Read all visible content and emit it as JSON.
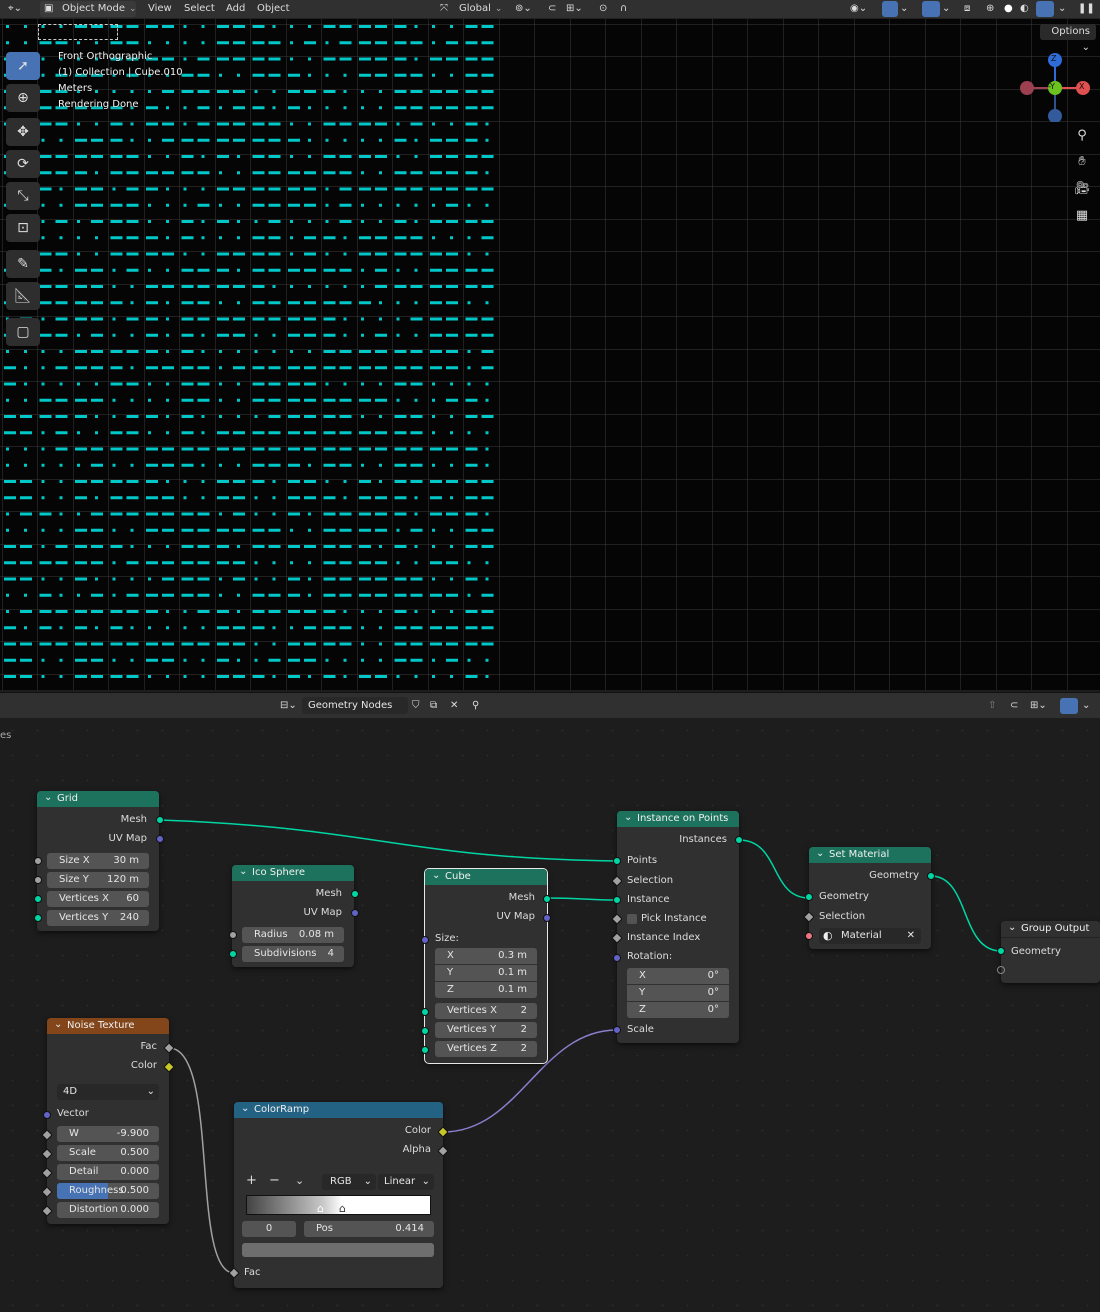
{
  "header": {
    "mode": "Object Mode",
    "menus": [
      "View",
      "Select",
      "Add",
      "Object"
    ],
    "transform_orientation": "Global"
  },
  "viewport": {
    "options_label": "Options",
    "overlay": [
      "Front Orthographic",
      "(1) Collection | Cube.010",
      "Meters",
      "Rendering Done"
    ],
    "gizmo": {
      "z": "Z",
      "y": "-Y",
      "x": "X"
    },
    "accent": "#00c8c8"
  },
  "node_header": {
    "tree_name": "Geometry Nodes"
  },
  "nodes": {
    "grid": {
      "title": "Grid",
      "out_mesh": "Mesh",
      "out_uv": "UV Map",
      "size_x": {
        "label": "Size X",
        "value": "30 m"
      },
      "size_y": {
        "label": "Size Y",
        "value": "120 m"
      },
      "verts_x": {
        "label": "Vertices X",
        "value": "60"
      },
      "verts_y": {
        "label": "Vertices Y",
        "value": "240"
      }
    },
    "ico": {
      "title": "Ico Sphere",
      "out_mesh": "Mesh",
      "out_uv": "UV Map",
      "radius": {
        "label": "Radius",
        "value": "0.08 m"
      },
      "subdiv": {
        "label": "Subdivisions",
        "value": "4"
      }
    },
    "cube": {
      "title": "Cube",
      "out_mesh": "Mesh",
      "out_uv": "UV Map",
      "size_label": "Size:",
      "x": {
        "label": "X",
        "value": "0.3 m"
      },
      "y": {
        "label": "Y",
        "value": "0.1 m"
      },
      "z": {
        "label": "Z",
        "value": "0.1 m"
      },
      "vx": {
        "label": "Vertices X",
        "value": "2"
      },
      "vy": {
        "label": "Vertices Y",
        "value": "2"
      },
      "vz": {
        "label": "Vertices Z",
        "value": "2"
      }
    },
    "iop": {
      "title": "Instance on Points",
      "out_instances": "Instances",
      "points": "Points",
      "selection": "Selection",
      "instance": "Instance",
      "pick": "Pick Instance",
      "index": "Instance Index",
      "rotation": "Rotation:",
      "rx": {
        "label": "X",
        "value": "0°"
      },
      "ry": {
        "label": "Y",
        "value": "0°"
      },
      "rz": {
        "label": "Z",
        "value": "0°"
      },
      "scale": "Scale"
    },
    "setmat": {
      "title": "Set Material",
      "out_geometry": "Geometry",
      "geometry": "Geometry",
      "selection": "Selection",
      "material": "Material"
    },
    "output": {
      "title": "Group Output",
      "geometry": "Geometry"
    },
    "noise": {
      "title": "Noise Texture",
      "out_fac": "Fac",
      "out_color": "Color",
      "dimensions": "4D",
      "vector": "Vector",
      "w": {
        "label": "W",
        "value": "-9.900"
      },
      "scale": {
        "label": "Scale",
        "value": "0.500"
      },
      "detail": {
        "label": "Detail",
        "value": "0.000"
      },
      "roughness": {
        "label": "Roughness",
        "value": "0.500"
      },
      "distortion": {
        "label": "Distortion",
        "value": "0.000"
      }
    },
    "ramp": {
      "title": "ColorRamp",
      "out_color": "Color",
      "out_alpha": "Alpha",
      "color_mode": "RGB",
      "interpolation": "Linear",
      "index": "0",
      "pos_label": "Pos",
      "pos_value": "0.414",
      "in_fac": "Fac"
    }
  }
}
